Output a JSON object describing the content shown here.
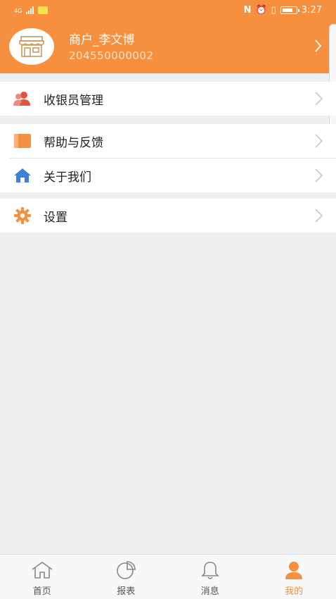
{
  "status_bar": {
    "network": "4G",
    "time": "3:27"
  },
  "profile": {
    "name": "商户_李文博",
    "id": "204550000002"
  },
  "menu": [
    {
      "label": "收银员管理",
      "icon": "cashier-management-icon"
    },
    {
      "label": "帮助与反馈",
      "icon": "help-feedback-icon"
    },
    {
      "label": "关于我们",
      "icon": "about-us-home-icon"
    },
    {
      "label": "设置",
      "icon": "settings-gear-icon"
    }
  ],
  "tabbar": [
    {
      "label": "首页",
      "icon": "home-icon",
      "active": false
    },
    {
      "label": "报表",
      "icon": "pie-chart-icon",
      "active": false
    },
    {
      "label": "消息",
      "icon": "bell-icon",
      "active": false
    },
    {
      "label": "我的",
      "icon": "user-icon",
      "active": true
    }
  ],
  "colors": {
    "accent": "#f7903e",
    "background": "#efeff1",
    "menu_icon_red": "#e8523f",
    "menu_icon_blue": "#3f7fd5"
  }
}
